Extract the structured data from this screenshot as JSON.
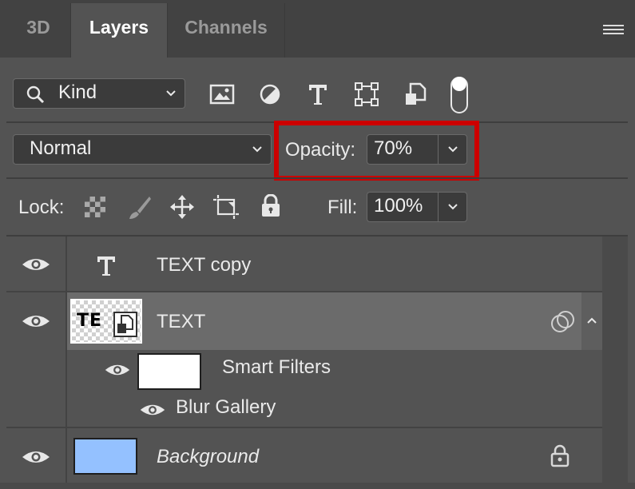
{
  "tabs": [
    {
      "label": "3D",
      "active": false
    },
    {
      "label": "Layers",
      "active": true
    },
    {
      "label": "Channels",
      "active": false
    }
  ],
  "filter": {
    "kind_label": "Kind",
    "icons": [
      "image-filter-icon",
      "adjustment-filter-icon",
      "type-filter-icon",
      "shape-filter-icon",
      "smart-object-filter-icon",
      "filter-toggle-switch"
    ]
  },
  "blend": {
    "mode": "Normal",
    "opacity_label": "Opacity:",
    "opacity_value": "70%"
  },
  "lock": {
    "label": "Lock:",
    "fill_label": "Fill:",
    "fill_value": "100%"
  },
  "layers": [
    {
      "name": "TEXT copy",
      "type": "text",
      "visible": true,
      "selected": false
    },
    {
      "name": "TEXT",
      "type": "smart-object",
      "visible": true,
      "selected": true,
      "thumb_text": "TE"
    },
    {
      "name": "Smart Filters",
      "type": "smart-filters",
      "visible": true
    },
    {
      "name": "Blur Gallery",
      "type": "filter",
      "visible": true
    },
    {
      "name": "Background",
      "type": "background",
      "visible": true,
      "locked": true
    }
  ],
  "colors": {
    "panel": "#535353",
    "tabbar": "#424242",
    "selected_row": "#6b6b6b",
    "highlight_box": "#cc0000",
    "background_swatch": "#94c1ff"
  }
}
